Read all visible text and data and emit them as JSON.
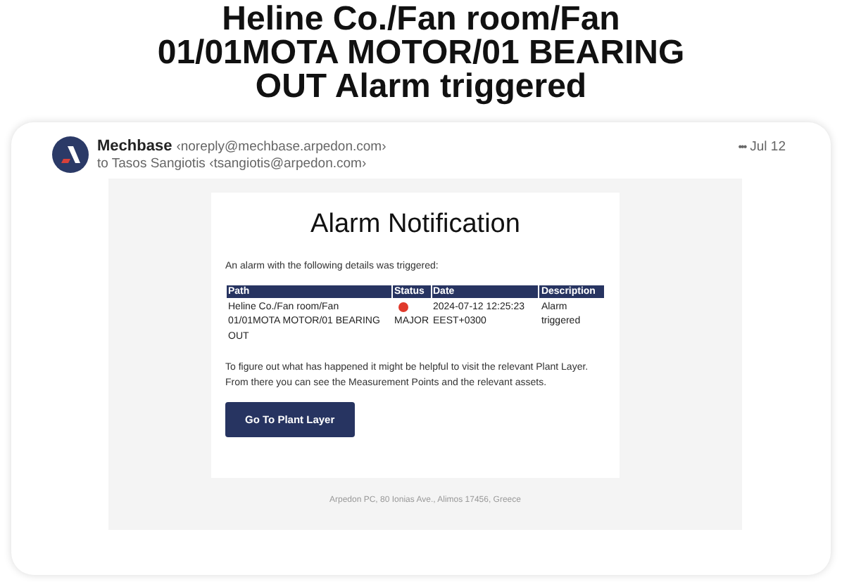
{
  "headline": "Heline Co./Fan room/Fan 01/01MOTA MOTOR/01 BEARING OUT Alarm triggered",
  "email": {
    "sender_name": "Mechbase",
    "sender_address": "‹noreply@mechbase.arpedon.com›",
    "recipient": "to Tasos Sangiotis ‹tsangiotis@arpedon.com›",
    "more": "•••",
    "date": "Jul 12"
  },
  "body": {
    "title": "Alarm Notification",
    "intro": "An alarm with the following details was triggered:",
    "table": {
      "columns": [
        "Path",
        "Status",
        "Date",
        "Description"
      ],
      "rows": [
        {
          "path": "Heline Co./Fan room/Fan 01/01MOTA MOTOR/01 BEARING OUT",
          "status": "MAJOR",
          "color": "#e0392b",
          "date": "2024-07-12 12:25:23 EEST+0300",
          "description": "Alarm triggered"
        }
      ]
    },
    "advice": "To figure out what has happened it might be helpful to visit the relevant Plant Layer. From there you can see the Measurement Points and the relevant assets.",
    "button": "Go To Plant Layer"
  },
  "footer": "Arpedon PC, 80 Ionias Ave., Alimos 17456, Greece"
}
